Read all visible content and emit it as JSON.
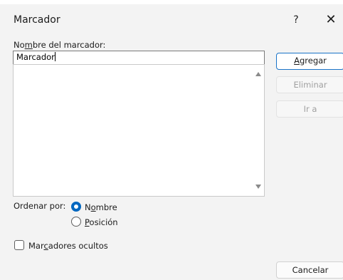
{
  "title_bar": {
    "title": "Marcador",
    "help": "?",
    "close": "✕"
  },
  "name_field": {
    "label_pre": "No",
    "label_accel": "m",
    "label_post": "bre del marcador:",
    "value": "Marcador"
  },
  "buttons": {
    "add_accel": "A",
    "add_rest": "gregar",
    "delete": "Eliminar",
    "goto": "Ir a",
    "cancel": "Cancelar"
  },
  "sort": {
    "label": "Ordenar por:",
    "name_pre": "N",
    "name_accel": "o",
    "name_post": "mbre",
    "position_accel": "P",
    "position_post": "osición",
    "selected": "Nombre"
  },
  "hidden": {
    "label_pre": "Mar",
    "label_accel": "c",
    "label_post": "adores ocultos",
    "checked": false
  }
}
